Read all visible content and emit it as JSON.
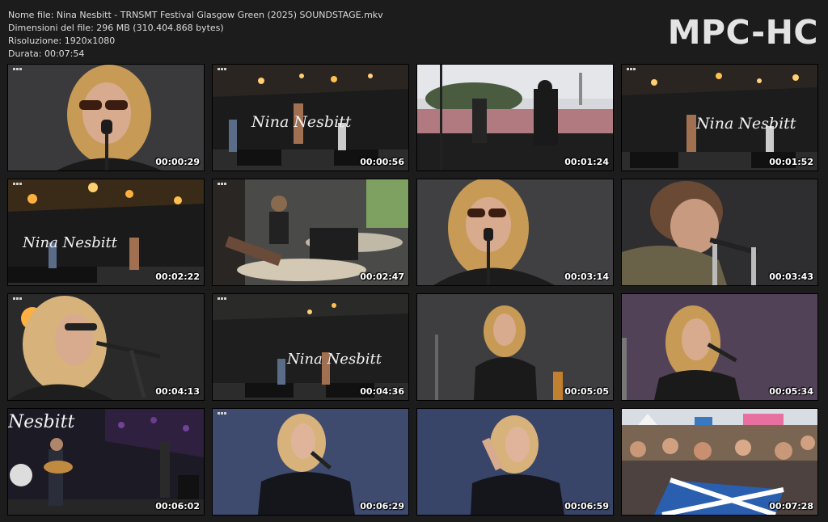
{
  "file_info": {
    "name_line": "Nome file: Nina Nesbitt - TRNSMT Festival Glasgow Green (2025) SOUNDSTAGE.mkv",
    "size_line": "Dimensioni del file: 296 MB (310.404.868 bytes)",
    "resolution_line": "Risoluzione: 1920x1080",
    "duration_line": "Durata: 00:07:54"
  },
  "brand": "MPC-HC",
  "stage_sign": "Nina Nesbitt",
  "stage_sign_partial": "Nesbitt",
  "thumbnails": [
    {
      "timestamp": "00:00:29",
      "scene": "closeup-sunglasses"
    },
    {
      "timestamp": "00:00:56",
      "scene": "stage-wide"
    },
    {
      "timestamp": "00:01:24",
      "scene": "crowd-from-stage"
    },
    {
      "timestamp": "00:01:52",
      "scene": "stage-wide"
    },
    {
      "timestamp": "00:02:22",
      "scene": "stage-wide-lights"
    },
    {
      "timestamp": "00:02:47",
      "scene": "drummer"
    },
    {
      "timestamp": "00:03:14",
      "scene": "closeup-sunglasses"
    },
    {
      "timestamp": "00:03:43",
      "scene": "male-singer"
    },
    {
      "timestamp": "00:04:13",
      "scene": "singer-side"
    },
    {
      "timestamp": "00:04:36",
      "scene": "stage-wide-dark"
    },
    {
      "timestamp": "00:05:05",
      "scene": "singer-mid"
    },
    {
      "timestamp": "00:05:34",
      "scene": "singer-purple"
    },
    {
      "timestamp": "00:06:02",
      "scene": "stage-guitarist"
    },
    {
      "timestamp": "00:06:29",
      "scene": "singer-blue"
    },
    {
      "timestamp": "00:06:59",
      "scene": "singer-blue-pose"
    },
    {
      "timestamp": "00:07:28",
      "scene": "festival-crowd"
    }
  ]
}
